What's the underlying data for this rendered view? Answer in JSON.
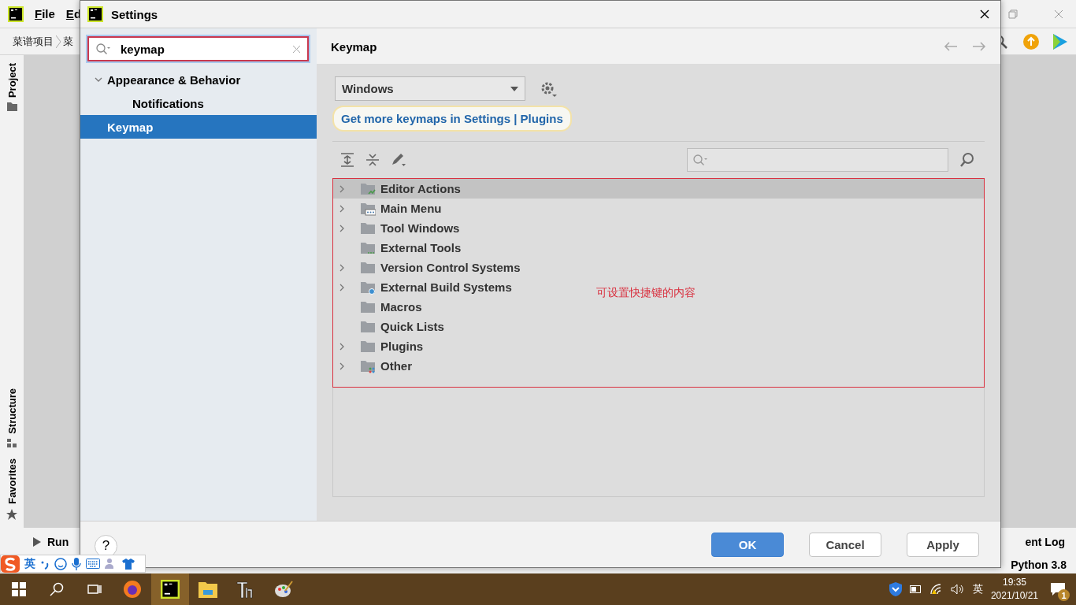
{
  "ide": {
    "menu": [
      "File",
      "Ed"
    ],
    "breadcrumbs": [
      "菜谱项目",
      "菜"
    ],
    "side_tabs": [
      {
        "label": "Project",
        "kind": "folder"
      },
      {
        "label": "Structure",
        "kind": "structure"
      },
      {
        "label": "Favorites",
        "kind": "star"
      }
    ],
    "bottom_tabs": [
      {
        "label": "Run",
        "kind": "run"
      },
      {
        "label": "ent Log",
        "kind": "log"
      }
    ],
    "status": "Python 3.8"
  },
  "dialog": {
    "title": "Settings",
    "search": {
      "value": "keymap"
    },
    "tree": [
      {
        "label": "Appearance & Behavior",
        "expanded": true,
        "selected": false,
        "children": [
          {
            "label": "Notifications",
            "selected": false
          }
        ]
      },
      {
        "label": "Keymap",
        "selected": true
      }
    ],
    "page_title": "Keymap",
    "keymap_select": "Windows",
    "link": "Get more keymaps in Settings | Plugins",
    "actions": [
      {
        "label": "Editor Actions",
        "expandable": true,
        "selected": true,
        "kind": "editor"
      },
      {
        "label": "Main Menu",
        "expandable": true,
        "selected": false,
        "kind": "menu"
      },
      {
        "label": "Tool Windows",
        "expandable": true,
        "selected": false,
        "kind": "plain"
      },
      {
        "label": "External Tools",
        "expandable": false,
        "selected": false,
        "kind": "tools"
      },
      {
        "label": "Version Control Systems",
        "expandable": true,
        "selected": false,
        "kind": "plain"
      },
      {
        "label": "External Build Systems",
        "expandable": true,
        "selected": false,
        "kind": "build"
      },
      {
        "label": "Macros",
        "expandable": false,
        "selected": false,
        "kind": "plain"
      },
      {
        "label": "Quick Lists",
        "expandable": false,
        "selected": false,
        "kind": "plain"
      },
      {
        "label": "Plugins",
        "expandable": true,
        "selected": false,
        "kind": "plain"
      },
      {
        "label": "Other",
        "expandable": true,
        "selected": false,
        "kind": "other"
      }
    ],
    "annotation": "可设置快捷键的内容",
    "help": "?",
    "buttons": [
      {
        "label": "OK",
        "primary": true
      },
      {
        "label": "Cancel",
        "primary": false
      },
      {
        "label": "Apply",
        "primary": false
      }
    ]
  },
  "ime": {
    "lang": "英"
  },
  "taskbar": {
    "apps": [
      {
        "kind": "firefox",
        "active": false
      },
      {
        "kind": "pycharm",
        "active": true
      },
      {
        "kind": "explorer",
        "active": false
      },
      {
        "kind": "typora",
        "active": false
      },
      {
        "kind": "paint",
        "active": false
      }
    ],
    "lang": "英",
    "time": "19:35",
    "date": "2021/10/21",
    "notifications": "1"
  }
}
